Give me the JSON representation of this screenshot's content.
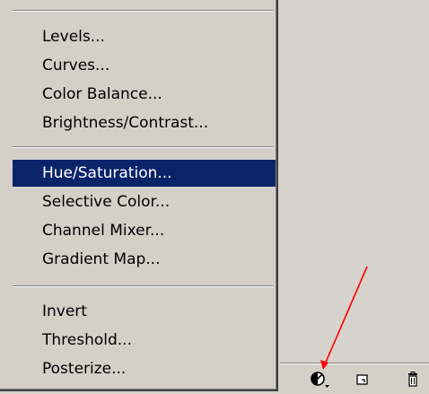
{
  "menu": {
    "group1": [
      "Levels...",
      "Curves...",
      "Color Balance...",
      "Brightness/Contrast..."
    ],
    "group2": [
      "Hue/Saturation...",
      "Selective Color...",
      "Channel Mixer...",
      "Gradient Map..."
    ],
    "group3": [
      "Invert",
      "Threshold...",
      "Posterize..."
    ],
    "selected": "Hue/Saturation..."
  },
  "toolbar": {
    "icons": [
      "adjustment-layer-icon",
      "new-layer-icon",
      "trash-icon"
    ]
  },
  "colors": {
    "selection": "#0a246a",
    "arrow": "#ff0000",
    "menu_bg": "#d4d0c8"
  }
}
